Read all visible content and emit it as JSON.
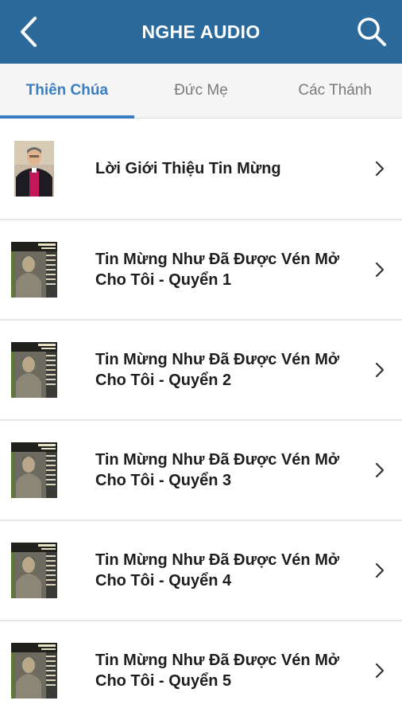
{
  "header": {
    "title": "NGHE AUDIO",
    "background": "#2b6a9a",
    "back_icon": "chevron-left-icon",
    "search_icon": "search-icon"
  },
  "tabs": [
    {
      "label": "Thiên Chúa",
      "active": true
    },
    {
      "label": "Đức Mẹ",
      "active": false
    },
    {
      "label": "Các Thánh",
      "active": false
    }
  ],
  "accent_color": "#3a7fc4",
  "items": [
    {
      "title": "Lời Giới Thiệu Tin Mừng",
      "thumb": "bishop-portrait"
    },
    {
      "title": "Tin Mừng Như Đã Được Vén Mở Cho Tôi - Quyển 1",
      "thumb": "book-cover"
    },
    {
      "title": "Tin Mừng Như Đã Được Vén Mở Cho Tôi - Quyển 2",
      "thumb": "book-cover"
    },
    {
      "title": "Tin Mừng Như Đã Được Vén Mở Cho Tôi - Quyển 3",
      "thumb": "book-cover"
    },
    {
      "title": "Tin Mừng Như Đã Được Vén Mở Cho Tôi - Quyển 4",
      "thumb": "book-cover"
    },
    {
      "title": "Tin Mừng Như Đã Được Vén Mở Cho Tôi - Quyển 5",
      "thumb": "book-cover"
    }
  ]
}
